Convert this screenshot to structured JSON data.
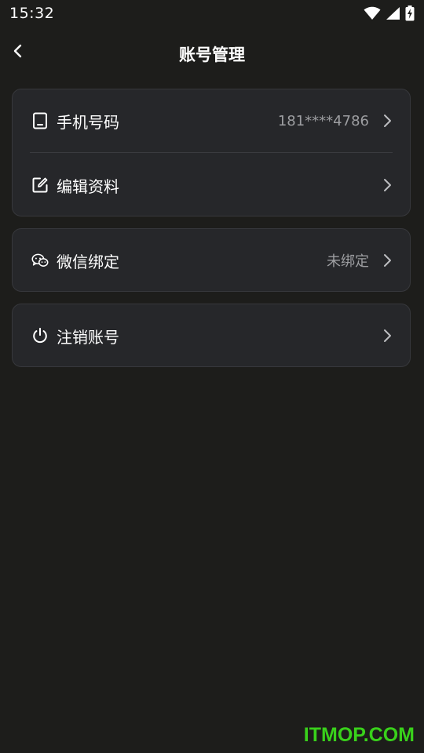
{
  "status_bar": {
    "time": "15:32",
    "icons": [
      "wifi-icon",
      "cellular-signal-icon",
      "battery-charging-icon"
    ]
  },
  "header": {
    "title": "账号管理",
    "back_icon": "chevron-left-icon"
  },
  "cards": [
    {
      "rows": [
        {
          "icon": "phone-icon",
          "label": "手机号码",
          "value": "181****4786",
          "chevron": "chevron-right-icon"
        },
        {
          "icon": "edit-icon",
          "label": "编辑资料",
          "value": "",
          "chevron": "chevron-right-icon"
        }
      ]
    },
    {
      "rows": [
        {
          "icon": "wechat-icon",
          "label": "微信绑定",
          "value": "未绑定",
          "chevron": "chevron-right-icon"
        }
      ]
    },
    {
      "rows": [
        {
          "icon": "power-icon",
          "label": "注销账号",
          "value": "",
          "chevron": "chevron-right-icon"
        }
      ]
    }
  ],
  "watermark": "ITMOP.COM",
  "colors": {
    "background": "#1d1d1b",
    "card": "#26272a",
    "secondary_text": "#9d9ea1",
    "watermark": "#39d11b"
  }
}
